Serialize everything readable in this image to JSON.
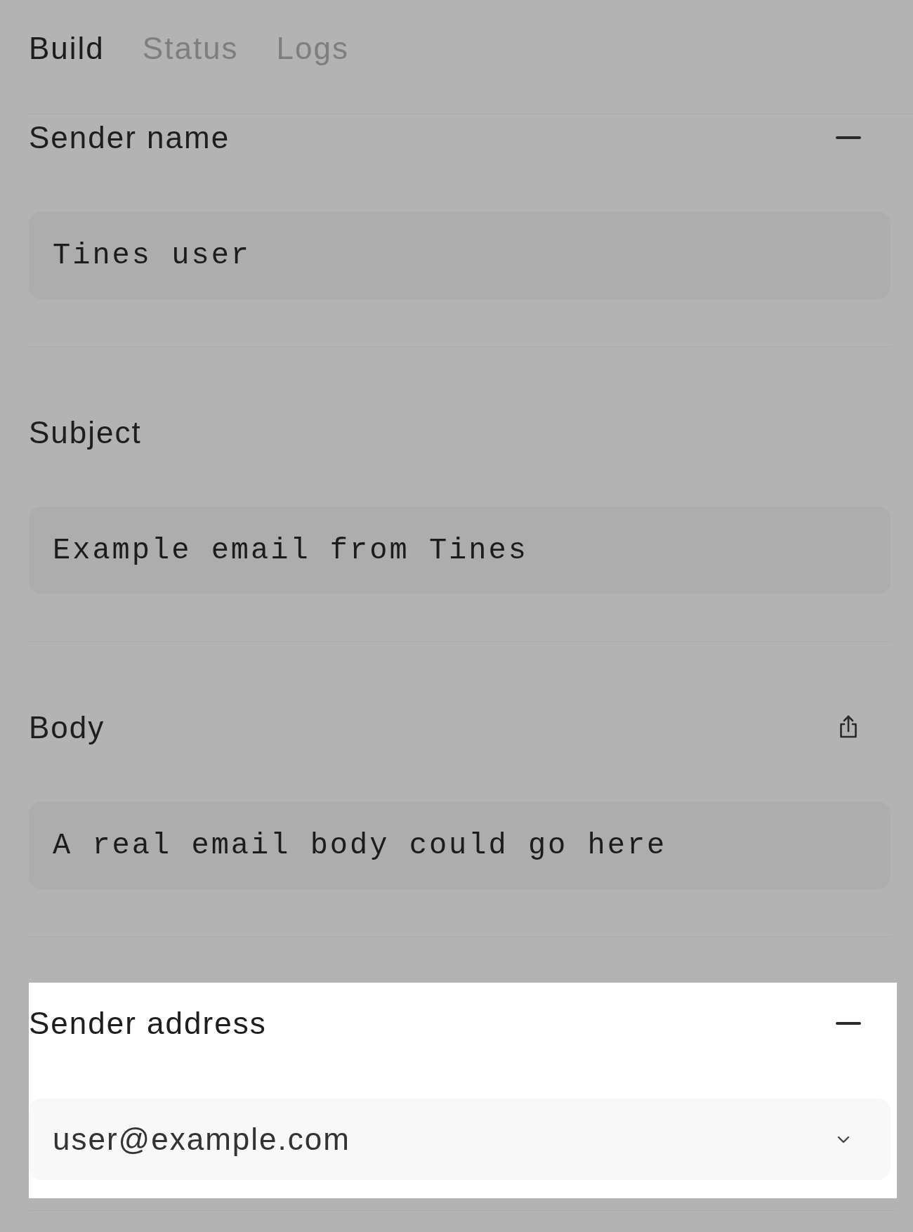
{
  "tabs": [
    {
      "label": "Build",
      "selected": true
    },
    {
      "label": "Status",
      "selected": false
    },
    {
      "label": "Logs",
      "selected": false
    }
  ],
  "sections": [
    {
      "label": "Sender name",
      "collapsible": true,
      "exportable": false,
      "kind": "text",
      "value": "Tines user",
      "highlighted": false
    },
    {
      "label": "Subject",
      "collapsible": false,
      "exportable": false,
      "kind": "text",
      "value": "Example email from Tines",
      "highlighted": false
    },
    {
      "label": "Body",
      "collapsible": false,
      "exportable": true,
      "kind": "text",
      "value": "A real email body could go here",
      "highlighted": false
    },
    {
      "label": "Sender address",
      "collapsible": true,
      "exportable": false,
      "kind": "select",
      "value": "user@example.com",
      "highlighted": true
    }
  ]
}
